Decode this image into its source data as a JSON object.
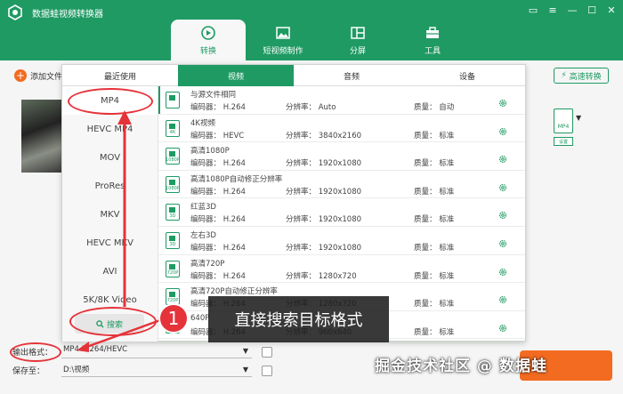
{
  "app": {
    "title": "数据蛙视频转换器"
  },
  "nav": {
    "items": [
      {
        "label": "转换",
        "icon": "convert-icon",
        "active": true
      },
      {
        "label": "短视频制作",
        "icon": "image-icon",
        "active": false
      },
      {
        "label": "分屏",
        "icon": "split-screen-icon",
        "active": false
      },
      {
        "label": "工具",
        "icon": "toolbox-icon",
        "active": false
      }
    ]
  },
  "toolbar": {
    "add_file": "添加文件",
    "fast_convert": "高速转换"
  },
  "format_panel": {
    "tabs": [
      "最近使用",
      "视频",
      "音频",
      "设备"
    ],
    "active_tab": "视频",
    "categories": [
      "MP4",
      "HEVC MP4",
      "MOV",
      "ProRes",
      "MKV",
      "HEVC MKV",
      "AVI",
      "5K/8K Video"
    ],
    "selected_category": "MP4",
    "search_label": "搜索",
    "enc_label": "编码器：",
    "res_label": "分辨率：",
    "qual_label": "质量：",
    "presets": [
      {
        "name": "与源文件相同",
        "encoder": "H.264",
        "resolution": "Auto",
        "quality": "自动",
        "badge": ""
      },
      {
        "name": "4K视频",
        "encoder": "HEVC",
        "resolution": "3840x2160",
        "quality": "标准",
        "badge": "4K"
      },
      {
        "name": "高清1080P",
        "encoder": "H.264",
        "resolution": "1920x1080",
        "quality": "标准",
        "badge": "1080P"
      },
      {
        "name": "高清1080P自动修正分辨率",
        "encoder": "H.264",
        "resolution": "1920x1080",
        "quality": "标准",
        "badge": "1080P"
      },
      {
        "name": "红蓝3D",
        "encoder": "H.264",
        "resolution": "1920x1080",
        "quality": "标准",
        "badge": "3D"
      },
      {
        "name": "左右3D",
        "encoder": "H.264",
        "resolution": "1920x1080",
        "quality": "标准",
        "badge": "3D"
      },
      {
        "name": "高清720P",
        "encoder": "H.264",
        "resolution": "1280x720",
        "quality": "标准",
        "badge": "720P"
      },
      {
        "name": "高清720P自动修正分辨率",
        "encoder": "H.264",
        "resolution": "1280x720",
        "quality": "标准",
        "badge": "720P"
      },
      {
        "name": "640P",
        "encoder": "H.264",
        "resolution": "960x640",
        "quality": "标准",
        "badge": "640P"
      }
    ]
  },
  "item": {
    "format_badge": "MP4",
    "settings_label": "设置"
  },
  "bottom": {
    "output_format_label": "输出格式：",
    "output_format_value": "MP4 H.264/HEVC",
    "save_to_label": "保存至：",
    "save_to_value": "D:\\视频"
  },
  "annotation": {
    "number": "1",
    "text": "直接搜索目标格式"
  },
  "watermark": "掘金技术社区 @ 数据蛙",
  "colors": {
    "brand_green": "#1f9a63",
    "accent_orange": "#f26b21",
    "annotation_red": "#e5333a"
  }
}
